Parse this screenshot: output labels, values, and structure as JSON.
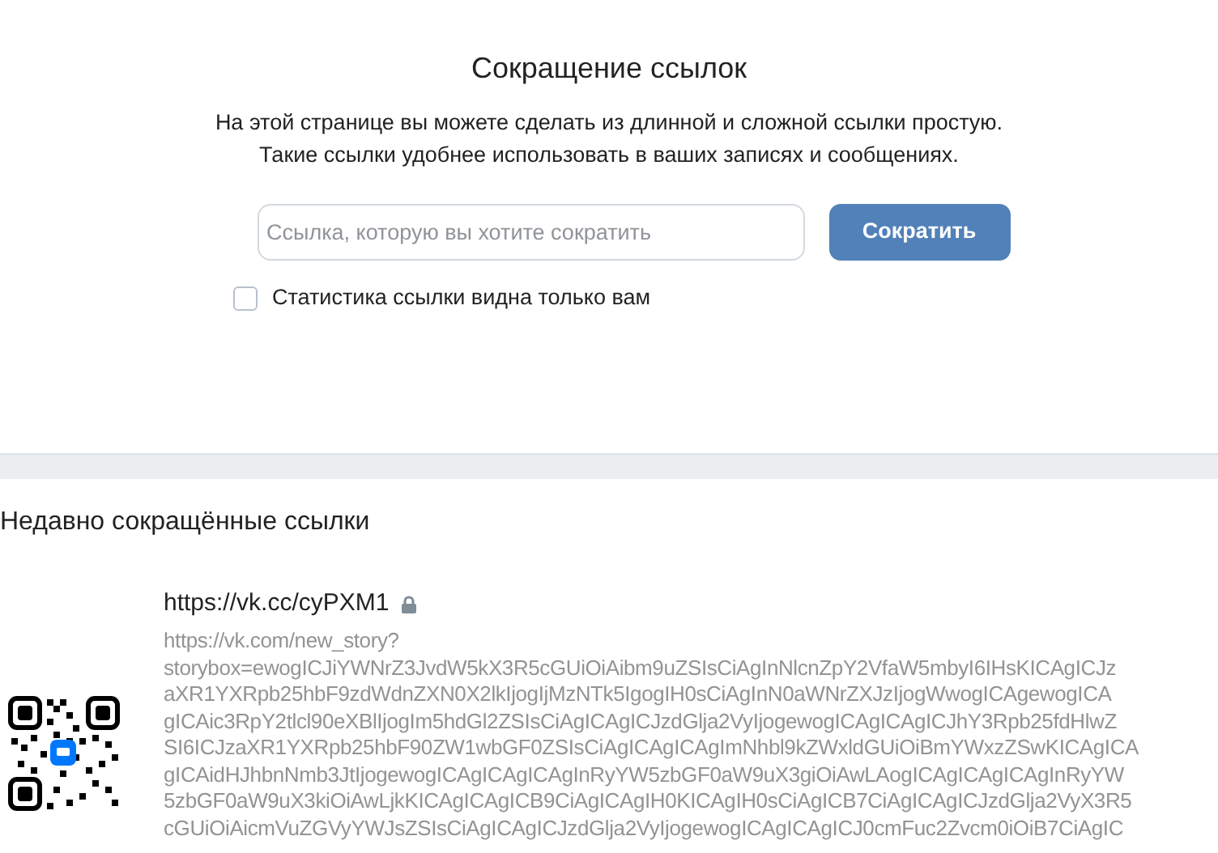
{
  "title": "Сокращение ссылок",
  "description": [
    "На этой странице вы можете сделать из длинной и сложной ссылки простую.",
    "Такие ссылки удобнее использовать в ваших записях и сообщениях."
  ],
  "url_field": {
    "placeholder": "Ссылка, которую вы хотите сократить"
  },
  "shorten_button": "Сократить",
  "private_stats": {
    "label": "Статистика ссылки видна только вам",
    "checked": false
  },
  "recent": {
    "heading": "Недавно сокращённые ссылки",
    "links": [
      {
        "short_url": "https://vk.cc/cyPXM1",
        "locked": true,
        "original_lines": [
          "https://vk.com/new_story?",
          "storybox=ewogICJiYWNrZ3JvdW5kX3R5cGUiOiAibm9uZSIsCiAgInNlcnZpY2VfaW5mbyI6IHsKICAgICJz",
          "aXR1YXRpb25hbF9zdWdnZXN0X2lkIjogIjMzNTk5IgogIH0sCiAgInN0aWNrZXJzIjogWwogICAgewogICA",
          "gICAic3RpY2tlcl90eXBlIjogIm5hdGl2ZSIsCiAgICAgICJzdGlja2VyIjogewogICAgICAgICJhY3Rpb25fdHlwZ",
          "SI6ICJzaXR1YXRpb25hbF90ZW1wbGF0ZSIsCiAgICAgICAgImNhbl9kZWxldGUiOiBmYWxzZSwKICAgICA",
          "gICAidHJhbnNmb3JtIjogewogICAgICAgICAgInRyYW5zbGF0aW9uX3giOiAwLAogICAgICAgICAgInRyYW",
          "5zbGF0aW9uX3kiOiAwLjkKICAgICAgICB9CiAgICAgIH0KICAgIH0sCiAgICB7CiAgICAgICJzdGlja2VyX3R5",
          "cGUiOiAicmVuZGVyYWJsZSIsCiAgICAgICJzdGlja2VyIjogewogICAgICAgICJ0cmFuc2Zvcm0iOiB7CiAgIC"
        ]
      }
    ]
  }
}
